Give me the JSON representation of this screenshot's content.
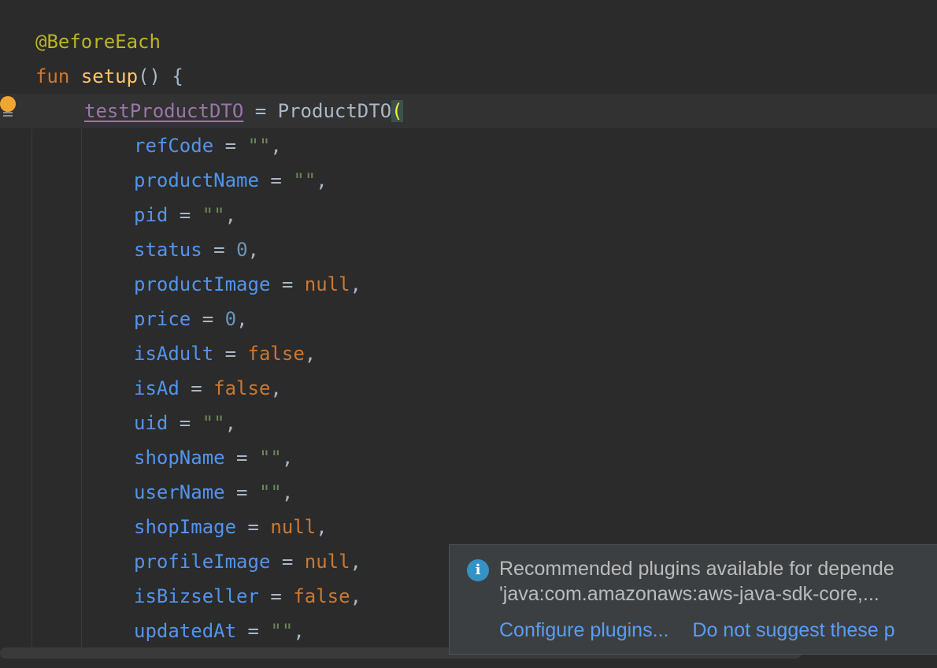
{
  "code": {
    "annotation": "@BeforeEach",
    "fun_keyword": "fun",
    "fun_name": "setup",
    "fun_tail": "() {",
    "assign_target": "testProductDTO",
    "assign_op": " = ",
    "ctor_name": "ProductDTO",
    "ctor_open": "(",
    "args": [
      {
        "name": "refCode",
        "value": "\"\"",
        "kind": "str"
      },
      {
        "name": "productName",
        "value": "\"\"",
        "kind": "str"
      },
      {
        "name": "pid",
        "value": "\"\"",
        "kind": "str"
      },
      {
        "name": "status",
        "value": "0",
        "kind": "num"
      },
      {
        "name": "productImage",
        "value": "null",
        "kind": "kw"
      },
      {
        "name": "price",
        "value": "0",
        "kind": "num"
      },
      {
        "name": "isAdult",
        "value": "false",
        "kind": "kw"
      },
      {
        "name": "isAd",
        "value": "false",
        "kind": "kw"
      },
      {
        "name": "uid",
        "value": "\"\"",
        "kind": "str"
      },
      {
        "name": "shopName",
        "value": "\"\"",
        "kind": "str"
      },
      {
        "name": "userName",
        "value": "\"\"",
        "kind": "str"
      },
      {
        "name": "shopImage",
        "value": "null",
        "kind": "kw"
      },
      {
        "name": "profileImage",
        "value": "null",
        "kind": "kw"
      },
      {
        "name": "isBizseller",
        "value": "false",
        "kind": "kw"
      },
      {
        "name": "updatedAt",
        "value": "\"\"",
        "kind": "str"
      }
    ]
  },
  "notification": {
    "icon": "info-icon",
    "line1": "Recommended plugins available for depende",
    "line2": "'java:com.amazonaws:aws-java-sdk-core,...",
    "action1": "Configure plugins...",
    "action2": "Do not suggest these p"
  },
  "colors": {
    "background": "#2b2b2b",
    "annotation": "#bbb529",
    "keyword": "#cc7832",
    "function": "#ffc66d",
    "property": "#9876aa",
    "parameter": "#5394ec",
    "string": "#6a8759",
    "number": "#6897bb",
    "link": "#589df6"
  }
}
